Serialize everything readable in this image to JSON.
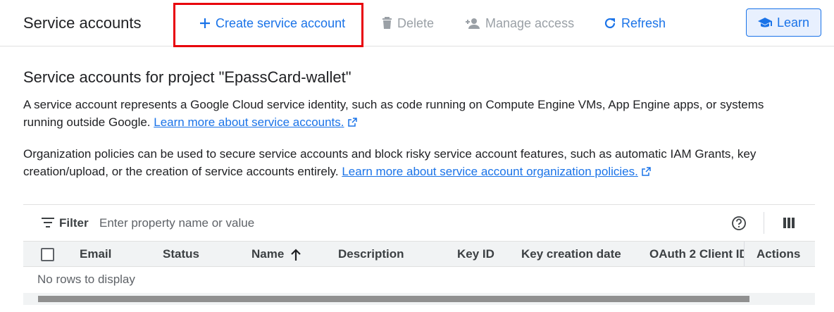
{
  "header": {
    "title": "Service accounts",
    "create_label": "Create service account",
    "delete_label": "Delete",
    "manage_label": "Manage access",
    "refresh_label": "Refresh",
    "learn_label": "Learn"
  },
  "main": {
    "section_title": "Service accounts for project \"EpassCard-wallet\"",
    "para1_text": "A service account represents a Google Cloud service identity, such as code running on Compute Engine VMs, App Engine apps, or systems running outside Google. ",
    "para1_link": "Learn more about service accounts.",
    "para2_text": "Organization policies can be used to secure service accounts and block risky service account features, such as automatic IAM Grants, key creation/upload, or the creation of service accounts entirely. ",
    "para2_link": "Learn more about service account organization policies."
  },
  "table": {
    "filter_label": "Filter",
    "filter_placeholder": "Enter property name or value",
    "columns": {
      "email": "Email",
      "status": "Status",
      "name": "Name",
      "description": "Description",
      "key_id": "Key ID",
      "key_creation_date": "Key creation date",
      "oauth": "OAuth 2 Client ID",
      "actions": "Actions"
    },
    "empty_text": "No rows to display"
  },
  "colors": {
    "accent": "#1a73e8",
    "highlight": "#e8000b",
    "disabled": "#9aa0a6"
  },
  "icons": [
    "plus-icon",
    "trash-icon",
    "person-add-icon",
    "refresh-icon",
    "school-cap-icon",
    "external-link-icon",
    "filter-icon",
    "help-icon",
    "columns-icon",
    "arrow-up-icon"
  ]
}
